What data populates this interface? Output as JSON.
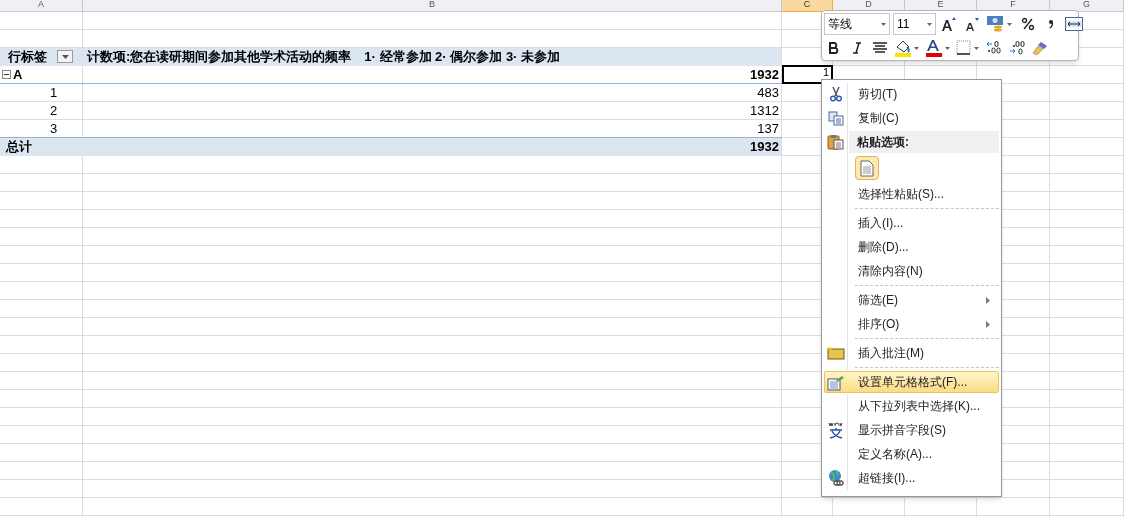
{
  "columns": [
    {
      "label": "A",
      "selected": false
    },
    {
      "label": "B",
      "selected": false
    },
    {
      "label": "C",
      "selected": true
    },
    {
      "label": "D",
      "selected": false
    },
    {
      "label": "E",
      "selected": false
    },
    {
      "label": "F",
      "selected": false
    },
    {
      "label": "G",
      "selected": false
    }
  ],
  "pivot": {
    "row_label_header": "行标签",
    "value_header": "计数项:您在读研期间参加其他学术活动的频率　1· 经常参加 2· 偶尔参加 3· 未参加",
    "rows": [
      {
        "kind": "group",
        "label": "A",
        "expanded": true,
        "value": "1932"
      },
      {
        "kind": "item",
        "label": "1",
        "value": "483"
      },
      {
        "kind": "item",
        "label": "2",
        "value": "1312"
      },
      {
        "kind": "item",
        "label": "3",
        "value": "137"
      }
    ],
    "total": {
      "label": "总计",
      "value": "1932"
    }
  },
  "active_cell": {
    "value": "1"
  },
  "mini_toolbar": {
    "font": "等线",
    "size": "11"
  },
  "context_menu": {
    "items": [
      {
        "kind": "item",
        "label": "剪切(T)",
        "selected": false
      },
      {
        "kind": "item",
        "label": "复制(C)",
        "selected": false
      },
      {
        "kind": "header",
        "label": "粘贴选项:"
      },
      {
        "kind": "paste_options"
      },
      {
        "kind": "item",
        "label": "选择性粘贴(S)...",
        "selected": false
      },
      {
        "kind": "separator"
      },
      {
        "kind": "item",
        "label": "插入(I)...",
        "selected": false
      },
      {
        "kind": "item",
        "label": "删除(D)...",
        "selected": false
      },
      {
        "kind": "item",
        "label": "清除内容(N)",
        "selected": false
      },
      {
        "kind": "separator"
      },
      {
        "kind": "submenu",
        "label": "筛选(E)",
        "selected": false
      },
      {
        "kind": "submenu",
        "label": "排序(O)",
        "selected": false
      },
      {
        "kind": "separator"
      },
      {
        "kind": "item",
        "label": "插入批注(M)",
        "selected": false
      },
      {
        "kind": "separator"
      },
      {
        "kind": "item",
        "label": "设置单元格格式(F)...",
        "selected": true
      },
      {
        "kind": "item",
        "label": "从下拉列表中选择(K)...",
        "selected": false
      },
      {
        "kind": "item",
        "label": "显示拼音字段(S)",
        "selected": false
      },
      {
        "kind": "item",
        "label": "定义名称(A)...",
        "selected": false
      },
      {
        "kind": "item",
        "label": "超链接(I)...",
        "selected": false
      }
    ]
  }
}
